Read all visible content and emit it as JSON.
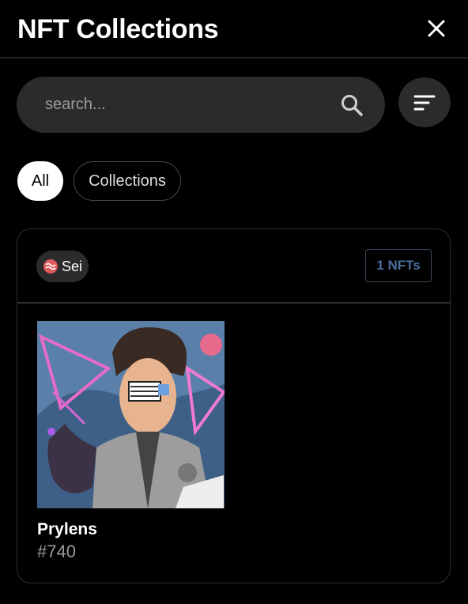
{
  "header": {
    "title": "NFT Collections"
  },
  "search": {
    "placeholder": "search..."
  },
  "tabs": [
    {
      "label": "All",
      "active": true
    },
    {
      "label": "Collections",
      "active": false
    }
  ],
  "collection": {
    "chain": "Sei",
    "count_label": "1 NFTs",
    "nfts": [
      {
        "name": "Prylens",
        "token_id": "#740"
      }
    ]
  },
  "colors": {
    "background": "#000000",
    "surface": "#2b2b2b",
    "accent_chain": "#e05a5a",
    "count_text": "#4a6d9a"
  },
  "icons": [
    "close-icon",
    "search-icon",
    "sort-icon",
    "sei-chain-icon"
  ]
}
